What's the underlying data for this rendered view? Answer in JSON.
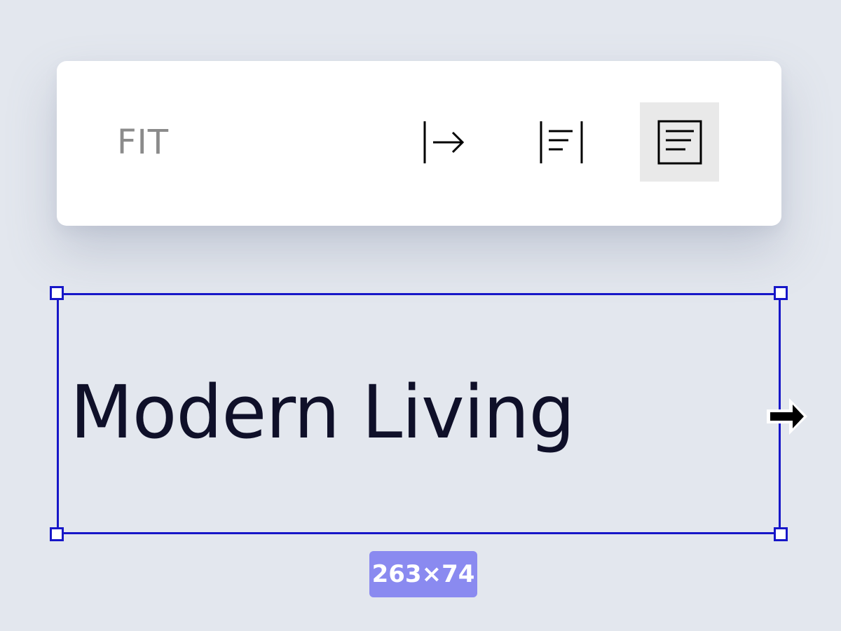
{
  "toolbar": {
    "label": "FIT",
    "buttons": [
      {
        "icon": "auto-width-icon",
        "active": false
      },
      {
        "icon": "fixed-width-icon",
        "active": false
      },
      {
        "icon": "fixed-size-icon",
        "active": true
      }
    ]
  },
  "canvas": {
    "text": "Modern Living",
    "dimensions": "263×74",
    "cursor": "resize-right-arrow-icon"
  },
  "colors": {
    "background": "#e3e7ee",
    "selection": "#1717c8",
    "badge": "#8a8af0",
    "text": "#0f1029",
    "active_button": "#e9e9e9"
  }
}
